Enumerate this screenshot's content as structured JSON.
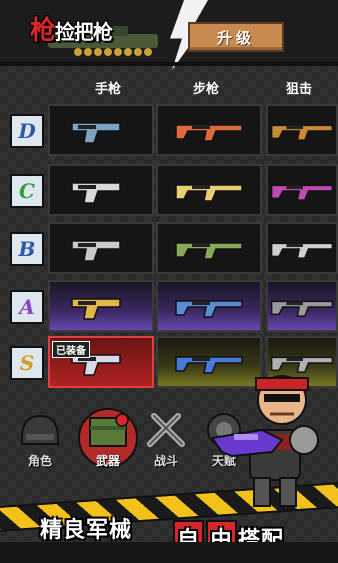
{
  "header": {
    "logo_text_red": "枪",
    "logo_text": "捡把",
    "logo_text_tail": "枪",
    "upgrade_label": "升级"
  },
  "columns": [
    "手枪",
    "步枪",
    "狙击"
  ],
  "tiers": [
    {
      "label": "D",
      "color": "#2b5aa8"
    },
    {
      "label": "C",
      "color": "#2f9a3f"
    },
    {
      "label": "B",
      "color": "#2b5aa8"
    },
    {
      "label": "A",
      "color": "#8a45c8"
    },
    {
      "label": "S",
      "color": "#d49a1a"
    }
  ],
  "selected_badge": "已装备",
  "weapon_colors": [
    [
      "#7da3c2",
      "#e06a3a",
      "#c98a35"
    ],
    [
      "#d8d8d8",
      "#e8d070",
      "#c04ab0"
    ],
    [
      "#c9c9c9",
      "#8aa85a",
      "#cfcfcf"
    ],
    [
      "#e0b84a",
      "#5a8ad0",
      "#9a9a9a"
    ],
    [
      "#d8d8e8",
      "#4a7ad8",
      "#b0b0b0"
    ]
  ],
  "nav": [
    {
      "label": "角色",
      "icon": "helmet-icon"
    },
    {
      "label": "武器",
      "icon": "weapon-crate-icon"
    },
    {
      "label": "战斗",
      "icon": "crossed-swords-icon"
    },
    {
      "label": "天赋",
      "icon": "talent-icon"
    }
  ],
  "slogan": {
    "part1": "精良军械",
    "part2_hl1": "自",
    "part2_hl2": "由",
    "part2_tail": "搭配"
  }
}
